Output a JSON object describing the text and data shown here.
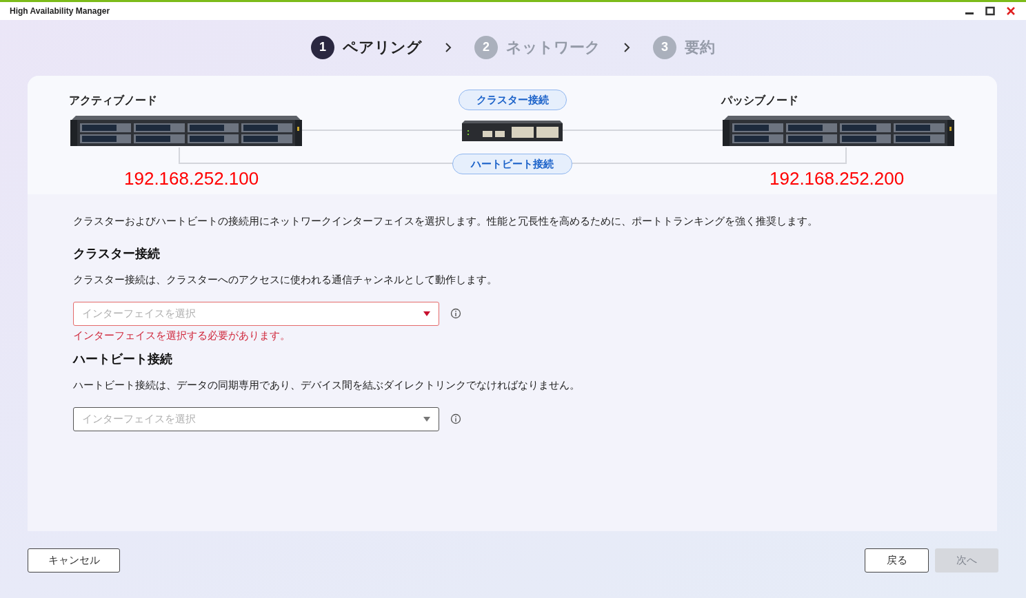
{
  "window": {
    "title": "High Availability Manager"
  },
  "steps": [
    {
      "number": "1",
      "label": "ペアリング",
      "selected": true
    },
    {
      "number": "2",
      "label": "ネットワーク",
      "selected": false
    },
    {
      "number": "3",
      "label": "要約",
      "selected": false
    }
  ],
  "diagram": {
    "active_node": {
      "label": "アクティブノード",
      "ip": "192.168.252.100"
    },
    "passive_node": {
      "label": "パッシブノード",
      "ip": "192.168.252.200"
    },
    "cluster_badge": "クラスター接続",
    "heartbeat_badge": "ハートビート接続"
  },
  "intro": "クラスターおよびハートビートの接続用にネットワークインターフェイスを選択します。性能と冗長性を高めるために、ポートトランキングを強く推奨します。",
  "sections": [
    {
      "title": "クラスター接続",
      "description": "クラスター接続は、クラスターへのアクセスに使われる通信チャンネルとして動作します。",
      "dropdown": {
        "placeholder": "インターフェイスを選択",
        "invalid": true,
        "error": "インターフェイスを選択する必要があります。"
      }
    },
    {
      "title": "ハートビート接続",
      "description": "ハートビート接続は、データの同期専用であり、デバイス間を結ぶダイレクトリンクでなければなりません。",
      "dropdown": {
        "placeholder": "インターフェイスを選択",
        "invalid": false
      }
    }
  ],
  "buttons": {
    "cancel": {
      "label": "キャンセル"
    },
    "back": {
      "label": "戻る"
    },
    "next": {
      "label": "次へ",
      "disabled": true
    }
  }
}
